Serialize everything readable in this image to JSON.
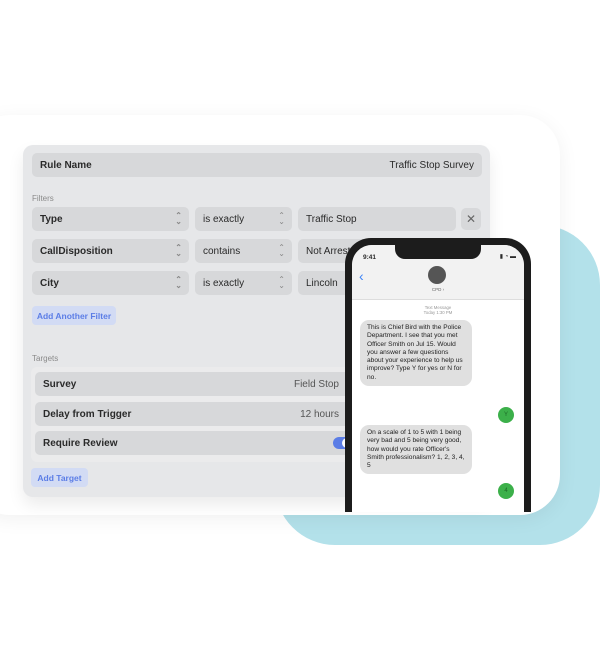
{
  "rule": {
    "label": "Rule Name",
    "value": "Traffic Stop Survey"
  },
  "filters": {
    "label": "Filters",
    "rows": [
      {
        "field": "Type",
        "op": "is exactly",
        "value": "Traffic Stop"
      },
      {
        "field": "CallDisposition",
        "op": "contains",
        "value": "Not Arrested"
      },
      {
        "field": "City",
        "op": "is exactly",
        "value": "Lincoln"
      }
    ],
    "add_label": "Add Another Filter"
  },
  "targets": {
    "label": "Targets",
    "survey": {
      "label": "Survey",
      "value": "Field Stop"
    },
    "delay": {
      "label": "Delay from Trigger",
      "value": "12 hours"
    },
    "review": {
      "label": "Require Review",
      "enabled": true
    },
    "add_label": "Add Target"
  },
  "colors": {
    "accent": "#5b7de6",
    "teal": "#b3e1ea",
    "reply": "#3cb04a"
  },
  "phone": {
    "time": "9:41",
    "contact": "CPD ›",
    "meta1": "Text Message",
    "meta2": "Today 1:30 PM",
    "messages": [
      {
        "from": "them",
        "text": "This is Chief Bird with the Police Department. I see that you met Officer Smith on Jul 15. Would you answer a few questions about your experience to help us improve? Type Y for yes or N for no."
      },
      {
        "from": "me",
        "text": "Y"
      },
      {
        "from": "them",
        "text": "On a scale of 1 to 5 with 1 being very bad and 5 being very good, how would you rate Officer's Smith professionalism? 1, 2, 3, 4, 5"
      },
      {
        "from": "me",
        "text": "4"
      }
    ]
  }
}
